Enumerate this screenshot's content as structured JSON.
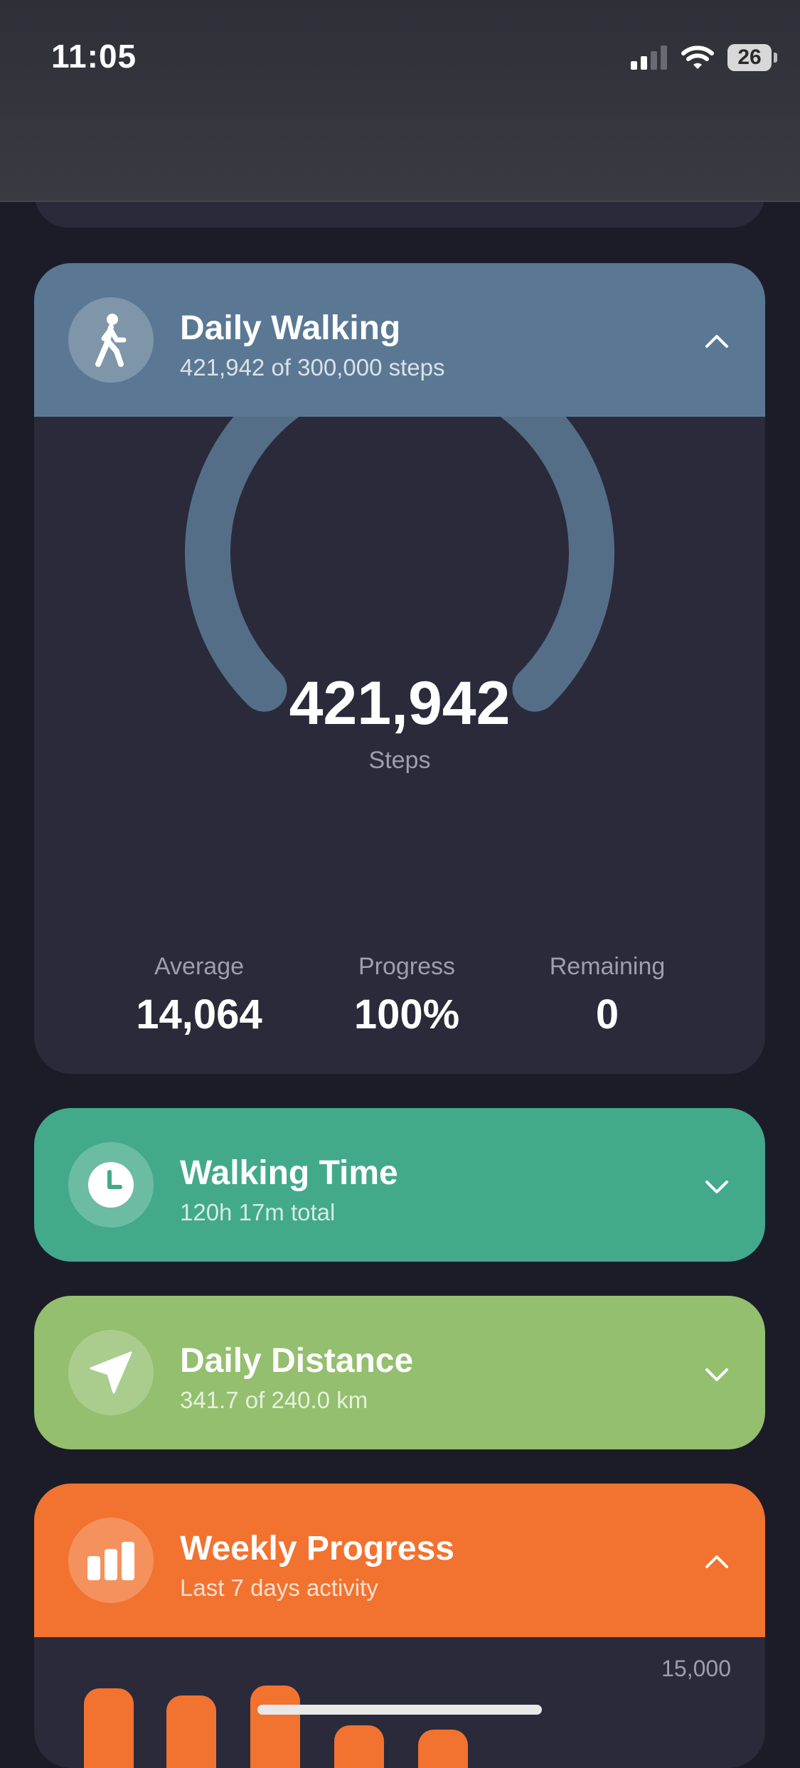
{
  "status_bar": {
    "time": "11:05",
    "battery": "26"
  },
  "cards": {
    "walking": {
      "title": "Daily Walking",
      "subtitle": "421,942 of 300,000 steps",
      "gauge_value": "421,942",
      "gauge_label": "Steps",
      "gauge_progress": 1.0,
      "stats": [
        {
          "label": "Average",
          "value": "14,064"
        },
        {
          "label": "Progress",
          "value": "100%"
        },
        {
          "label": "Remaining",
          "value": "0"
        }
      ]
    },
    "walking_time": {
      "title": "Walking Time",
      "subtitle": "120h 17m total"
    },
    "distance": {
      "title": "Daily Distance",
      "subtitle": "341.7 of 240.0 km"
    },
    "weekly": {
      "title": "Weekly Progress",
      "subtitle": "Last 7 days activity",
      "axis_max": "15,000"
    }
  },
  "colors": {
    "walking": "#5a7893",
    "walking_time": "#43a98b",
    "distance": "#93bf6e",
    "weekly": "#f2722f",
    "card_bg": "#2a2a3b",
    "page_bg": "#1c1c28"
  }
}
